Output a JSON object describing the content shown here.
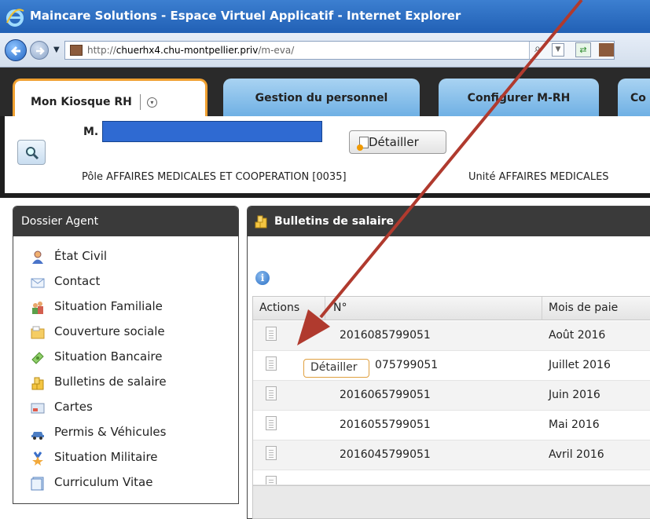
{
  "window": {
    "title": "Maincare Solutions - Espace Virtuel Applicatif - Internet Explorer"
  },
  "address_bar": {
    "url_prefix": "http://",
    "url_host": "chuerhx4.chu-montpellier.priv",
    "url_path": "/m-eva/",
    "search_glyph": "⌕",
    "dropdown_glyph": "▼",
    "refresh_glyph": "⇄"
  },
  "tabs": [
    {
      "label": "Mon Kiosque RH",
      "active": true
    },
    {
      "label": "Gestion du personnel",
      "active": false
    },
    {
      "label": "Configurer M-RH",
      "active": false
    },
    {
      "label": "Co",
      "active": false
    }
  ],
  "tab_menu_glyph": "▾",
  "identity": {
    "title_prefix": "M.",
    "detail_button": "Détailler",
    "pole": "Pôle AFFAIRES MEDICALES ET COOPERATION [0035]",
    "unite": "Unité AFFAIRES MEDICALES"
  },
  "sidebar": {
    "title": "Dossier Agent",
    "items": [
      {
        "label": "État Civil",
        "icon": "person-icon"
      },
      {
        "label": "Contact",
        "icon": "envelope-icon"
      },
      {
        "label": "Situation Familiale",
        "icon": "family-icon"
      },
      {
        "label": "Couverture sociale",
        "icon": "folder-icon"
      },
      {
        "label": "Situation Bancaire",
        "icon": "money-icon"
      },
      {
        "label": "Bulletins de salaire",
        "icon": "coins-icon"
      },
      {
        "label": "Cartes",
        "icon": "card-icon"
      },
      {
        "label": "Permis & Véhicules",
        "icon": "car-icon"
      },
      {
        "label": "Situation Militaire",
        "icon": "medal-icon"
      },
      {
        "label": "Curriculum Vitae",
        "icon": "cv-icon"
      }
    ]
  },
  "payslips": {
    "title": "Bulletins de salaire",
    "info_glyph": "i",
    "columns": [
      "Actions",
      "N°",
      "Mois de paie"
    ],
    "rows": [
      {
        "numero": "2016085799051",
        "mois": "Août 2016"
      },
      {
        "numero": "075799051",
        "mois": "Juillet 2016"
      },
      {
        "numero": "2016065799051",
        "mois": "Juin 2016"
      },
      {
        "numero": "2016055799051",
        "mois": "Mai 2016"
      },
      {
        "numero": "2016045799051",
        "mois": "Avril 2016"
      }
    ],
    "tooltip": "Détailler"
  },
  "colors": {
    "ie_titlebar": "#2160b5",
    "tab_active_border": "#f0a030",
    "tab_inactive": "#6fb0e4",
    "panel_header": "#3a3a3a",
    "annotation_arrow": "#b03a2e"
  }
}
